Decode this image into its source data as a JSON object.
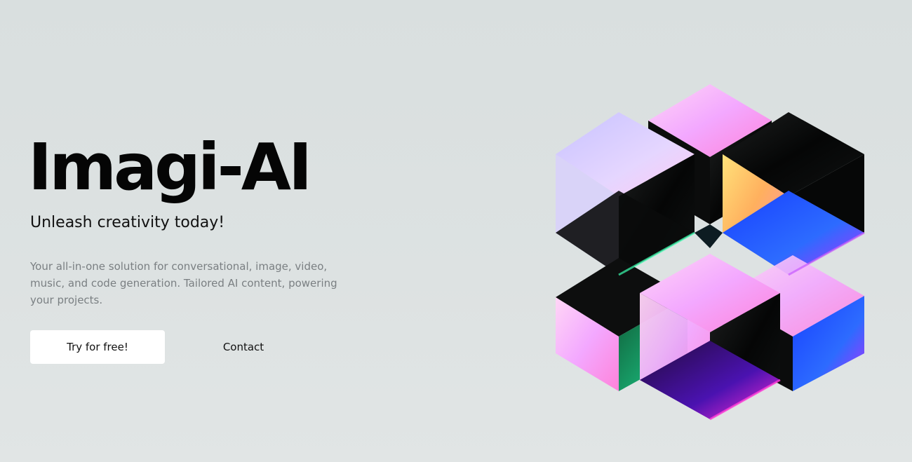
{
  "hero": {
    "title": "Imagi-AI",
    "tagline": "Unleash creativity today!",
    "description": "Your all-in-one solution for conversational, image, video, music, and code generation. Tailored AI content, powering your projects.",
    "primary_button": "Try for free!",
    "secondary_button": "Contact"
  },
  "colors": {
    "background": "#dadfdf",
    "title": "#050505",
    "description": "#7a7f82",
    "button_bg": "#ffffff"
  },
  "illustration": {
    "icon": "iridescent-cubes-illustration"
  }
}
